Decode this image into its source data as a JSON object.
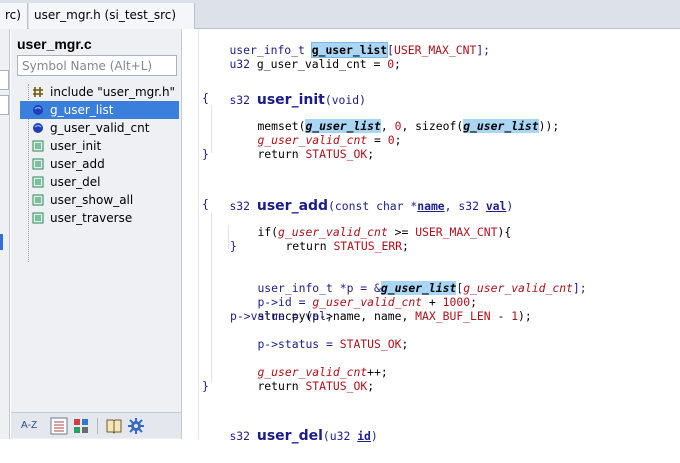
{
  "tabs": [
    {
      "label": "rc)"
    },
    {
      "label": "user_mgr.h (si_test_src)"
    }
  ],
  "symbol_panel": {
    "title": "user_mgr.c",
    "search_placeholder": "Symbol Name (Alt+L)",
    "items": [
      {
        "label": "include \"user_mgr.h\"",
        "icon": "include-icon",
        "selected": false
      },
      {
        "label": "g_user_list",
        "icon": "variable-icon",
        "selected": true
      },
      {
        "label": "g_user_valid_cnt",
        "icon": "variable-icon",
        "selected": false
      },
      {
        "label": "user_init",
        "icon": "function-icon",
        "selected": false
      },
      {
        "label": "user_add",
        "icon": "function-icon",
        "selected": false
      },
      {
        "label": "user_del",
        "icon": "function-icon",
        "selected": false
      },
      {
        "label": "user_show_all",
        "icon": "function-icon",
        "selected": false
      },
      {
        "label": "user_traverse",
        "icon": "function-icon",
        "selected": false
      }
    ],
    "toolbar": [
      "sort-az-icon",
      "list-view-icon",
      "category-view-icon",
      "book-icon",
      "settings-icon"
    ],
    "toolbar_text": {
      "sort": "A-Z"
    }
  },
  "code": {
    "l1": {
      "type": "user_info_t ",
      "var": "g_user_list",
      "open": "[",
      "macro": "USER_MAX_CNT",
      "close": "];"
    },
    "l2": {
      "type": "u32 ",
      "var": "g_user_valid_cnt",
      "rest": " = ",
      "num": "0",
      "end": ";"
    },
    "l4": {
      "ret": "s32 ",
      "fn": "user_init",
      "args": "(void)"
    },
    "l5": "{",
    "l6": {
      "call": "memset(",
      "a1": "g_user_list",
      "sep1": ", ",
      "n": "0",
      "sep2": ", sizeof(",
      "a2": "g_user_list",
      "end": "));"
    },
    "l7": {
      "var": "g_user_valid_cnt",
      "rest": " = ",
      "num": "0",
      "end": ";"
    },
    "l8": {
      "kw": "return ",
      "mac": "STATUS_OK",
      "end": ";"
    },
    "l9": "}",
    "l11": {
      "ret": "s32 ",
      "fn": "user_add",
      "a_open": "(const char *",
      "p1": "name",
      "a_mid": ", s32 ",
      "p2": "val",
      "a_close": ")"
    },
    "l12": "{",
    "l13": {
      "kw": "if(",
      "var": "g_user_valid_cnt",
      "op": " >= ",
      "mac": "USER_MAX_CNT",
      "end": "){"
    },
    "l14": {
      "kw": "return ",
      "mac": "STATUS_ERR",
      "end": ";"
    },
    "l15": "}",
    "l17": {
      "type": "user_info_t *p = &",
      "var": "g_user_list",
      "open": "[",
      "idx": "g_user_valid_cnt",
      "close": "];"
    },
    "l18": {
      "lhs": "p->id = ",
      "var": "g_user_valid_cnt",
      "op": " + ",
      "num": "1000",
      "end": ";"
    },
    "l19": {
      "call": "strncpy(p->name, name, ",
      "mac": "MAX_BUF_LEN",
      "op": " - ",
      "num": "1",
      "end": ");"
    },
    "l20": {
      "text": "p->value = val;"
    },
    "l21": {
      "lhs": "p->status = ",
      "mac": "STATUS_OK",
      "end": ";"
    },
    "l23": {
      "var": "g_user_valid_cnt",
      "end": "++;"
    },
    "l24": {
      "kw": "return ",
      "mac": "STATUS_OK",
      "end": ";"
    },
    "l25": "}",
    "l27": {
      "ret": "s32 ",
      "fn": "user_del",
      "a_open": "(u32 ",
      "p1": "id",
      "a_close": ")"
    }
  },
  "colors": {
    "selection": "#3b7fdc",
    "highlight": "#a9d6f5",
    "macro": "#b0101a",
    "keyword": "#1c1c8c"
  }
}
